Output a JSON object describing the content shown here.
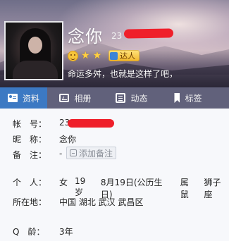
{
  "profile": {
    "nickname": "念你",
    "qq_prefix": "23",
    "signature": "命运多舛，也就是这样了吧，",
    "daren_label": "达人"
  },
  "tabs": [
    {
      "label": "资料",
      "active": true,
      "icon": "card-icon"
    },
    {
      "label": "相册",
      "active": false,
      "icon": "album-icon"
    },
    {
      "label": "动态",
      "active": false,
      "icon": "feed-icon"
    },
    {
      "label": "标签",
      "active": false,
      "icon": "tag-icon"
    }
  ],
  "details": {
    "account_label": "帐　号：",
    "account_value": "23",
    "nickname_label": "昵　称：",
    "nickname_value": "念你",
    "note_label": "备　注：",
    "note_value": "-",
    "add_note_label": "添加备注",
    "personal_label": "个　人：",
    "gender": "女",
    "age": "19岁",
    "birthday": "8月19日(公历生日)",
    "zodiac": "属鼠",
    "constellation": "狮子座",
    "location_label": "所在地：",
    "location": "中国 湖北 武汉 武昌区",
    "qage_label": "Q　龄：",
    "qage": "3年"
  },
  "colors": {
    "active_tab": "#3c79c3",
    "redaction": "#ef1f2a",
    "badge": "#f2b72c"
  }
}
